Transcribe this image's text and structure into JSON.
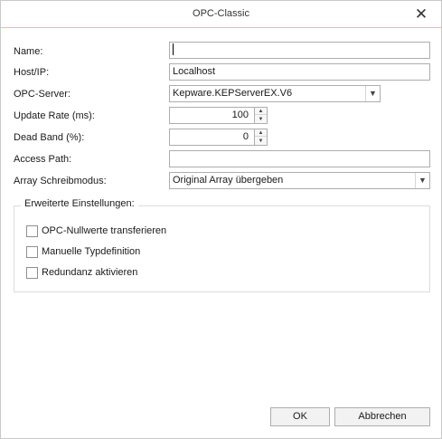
{
  "window": {
    "title": "OPC-Classic",
    "close_glyph": "✕",
    "close_icon": "close-icon"
  },
  "form": {
    "name": {
      "label": "Name:",
      "value": ""
    },
    "host": {
      "label": "Host/IP:",
      "value": "Localhost"
    },
    "server": {
      "label": "OPC-Server:",
      "value": "Kepware.KEPServerEX.V6"
    },
    "update_rate": {
      "label": "Update Rate (ms):",
      "value": "100"
    },
    "dead_band": {
      "label": "Dead Band (%):",
      "value": "0"
    },
    "access_path": {
      "label": "Access Path:",
      "value": ""
    },
    "array_mode": {
      "label": "Array Schreibmodus:",
      "value": "Original Array übergeben"
    }
  },
  "advanced": {
    "title": "Erweiterte Einstellungen:",
    "options": [
      {
        "label": "OPC-Nullwerte transferieren",
        "checked": false
      },
      {
        "label": "Manuelle Typdefinition",
        "checked": false
      },
      {
        "label": "Redundanz aktivieren",
        "checked": false
      }
    ]
  },
  "buttons": {
    "ok": "OK",
    "cancel": "Abbrechen"
  }
}
